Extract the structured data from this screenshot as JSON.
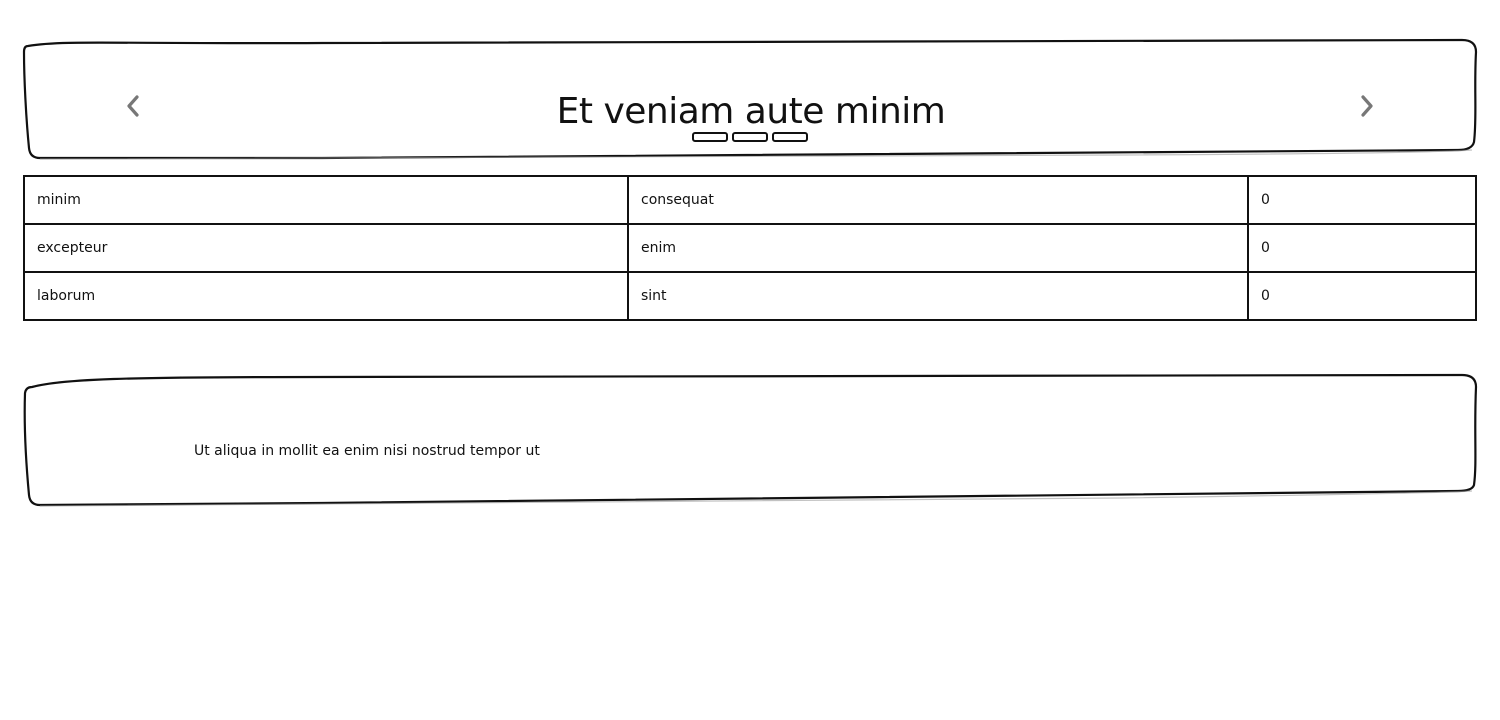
{
  "carousel": {
    "title": "Et veniam aute minim",
    "indicator_count": 3,
    "active_indicator": 0
  },
  "table": {
    "rows": [
      {
        "col1": "minim",
        "col2": "consequat",
        "col3": "0"
      },
      {
        "col1": "excepteur",
        "col2": "enim",
        "col3": "0"
      },
      {
        "col1": "laborum",
        "col2": "sint",
        "col3": "0"
      }
    ]
  },
  "text_card": {
    "body": "Ut aliqua in mollit ea enim nisi nostrud tempor ut"
  },
  "colors": {
    "stroke": "#111111",
    "arrow": "#777777",
    "background": "#ffffff"
  }
}
